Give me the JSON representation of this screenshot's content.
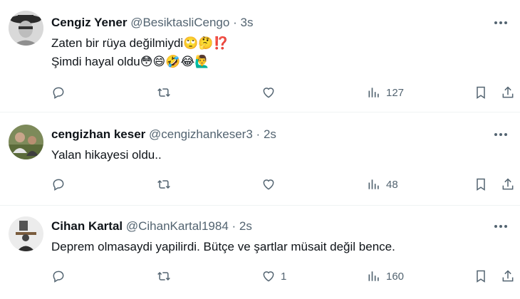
{
  "tweets": [
    {
      "name": "Cengiz Yener",
      "handle": "@BesiktasliCengo",
      "separator": "·",
      "time": "3s",
      "lines": [
        "Zaten bir rüya değilmiydi🙄🤔⁉️",
        "Şimdi hayal oldu😳😄🤣😂🙋‍♂️"
      ],
      "replies": "",
      "retweets": "",
      "likes": "",
      "views": "127"
    },
    {
      "name": "cengizhan keser",
      "handle": "@cengizhankeser3",
      "separator": "·",
      "time": "2s",
      "lines": [
        "Yalan hikayesi oldu.."
      ],
      "replies": "",
      "retweets": "",
      "likes": "",
      "views": "48"
    },
    {
      "name": "Cihan Kartal",
      "handle": "@CihanKartal1984",
      "separator": "·",
      "time": "2s",
      "lines": [
        "Deprem olmasaydi yapilirdi. Bütçe ve şartlar müsait değil bence."
      ],
      "replies": "",
      "retweets": "",
      "likes": "1",
      "views": "160"
    }
  ],
  "icons": {
    "reply": "reply-icon",
    "retweet": "retweet-icon",
    "like": "heart-icon",
    "views": "views-icon",
    "bookmark": "bookmark-icon",
    "share": "share-icon",
    "more": "more-icon"
  },
  "colors": {
    "text": "#0f1419",
    "muted": "#536471",
    "divider": "#eff3f4"
  }
}
